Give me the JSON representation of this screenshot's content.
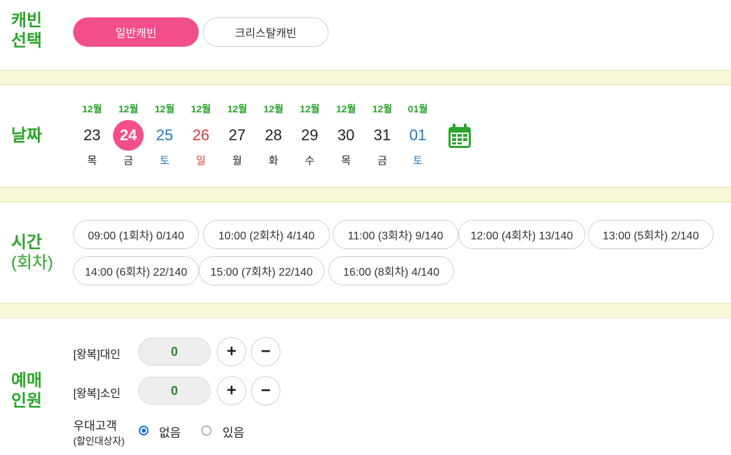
{
  "cabin": {
    "label_line1": "캐빈",
    "label_line2": "선택",
    "options": [
      "일반캐빈",
      "크리스탈캐빈"
    ],
    "selected": "일반캐빈"
  },
  "date": {
    "label": "날짜",
    "items": [
      {
        "month": "12월",
        "day": "23",
        "dow": "목"
      },
      {
        "month": "12월",
        "day": "24",
        "dow": "금"
      },
      {
        "month": "12월",
        "day": "25",
        "dow": "토"
      },
      {
        "month": "12월",
        "day": "26",
        "dow": "일"
      },
      {
        "month": "12월",
        "day": "27",
        "dow": "월"
      },
      {
        "month": "12월",
        "day": "28",
        "dow": "화"
      },
      {
        "month": "12월",
        "day": "29",
        "dow": "수"
      },
      {
        "month": "12월",
        "day": "30",
        "dow": "목"
      },
      {
        "month": "12월",
        "day": "31",
        "dow": "금"
      },
      {
        "month": "01월",
        "day": "01",
        "dow": "토"
      }
    ],
    "selected_day": "24",
    "calendar_icon": "calendar-icon",
    "colors": {
      "saturday": "#1f7ac0",
      "sunday": "#e03a3a",
      "selected": "#f24e8b"
    }
  },
  "time": {
    "label_line1": "시간",
    "label_line2": "(회차)",
    "slots": [
      "09:00 (1회차)  0/140",
      "10:00 (2회차)  4/140",
      "11:00 (3회차)  9/140",
      "12:00 (4회차)  13/140",
      "13:00 (5회차)  2/140",
      "14:00 (6회차)  22/140",
      "15:00 (7회차)  22/140",
      "16:00 (8회차)  4/140"
    ]
  },
  "passengers": {
    "label_line1": "예매",
    "label_line2": "인원",
    "adult_label": "[왕복]대인",
    "adult_count": "0",
    "child_label": "[왕복]소인",
    "child_count": "0",
    "plus": "+",
    "minus": "−",
    "discount_label": "우대고객",
    "discount_sub": "(할인대상자)",
    "discount_options": [
      "없음",
      "있음"
    ],
    "discount_selected": "없음"
  },
  "colors": {
    "accent": "#f24e8b",
    "green": "#2aa52a",
    "divider": "#f8f8d8"
  }
}
